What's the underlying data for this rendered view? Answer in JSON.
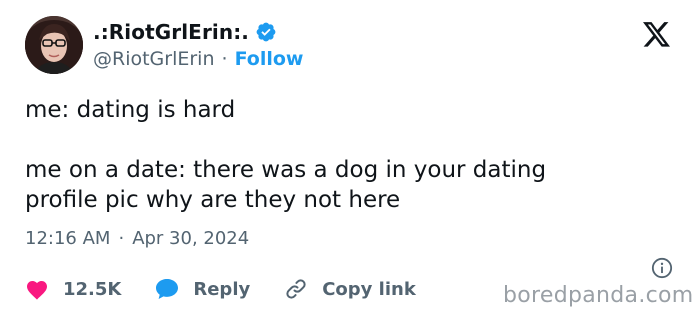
{
  "author": {
    "display_name": ".:RiotGrlErin:.",
    "handle": "@RiotGrlErin",
    "separator": "·",
    "follow_label": "Follow"
  },
  "tweet": {
    "line1": "me: dating is hard",
    "line2": "me on a date: there was a dog in your dating",
    "line3": "profile pic why are they not here"
  },
  "meta": {
    "time": "12:16 AM",
    "separator": "·",
    "date": "Apr 30, 2024"
  },
  "actions": {
    "like_count": "12.5K",
    "reply_label": "Reply",
    "copy_link_label": "Copy link"
  },
  "watermark": "boredpanda.com",
  "colors": {
    "brand_blue": "#1d9bf0",
    "like_pink": "#f91880",
    "muted": "#536471"
  },
  "icons": [
    "verified-icon",
    "x-logo-icon",
    "info-icon",
    "heart-icon",
    "reply-bubble-icon",
    "link-icon"
  ]
}
